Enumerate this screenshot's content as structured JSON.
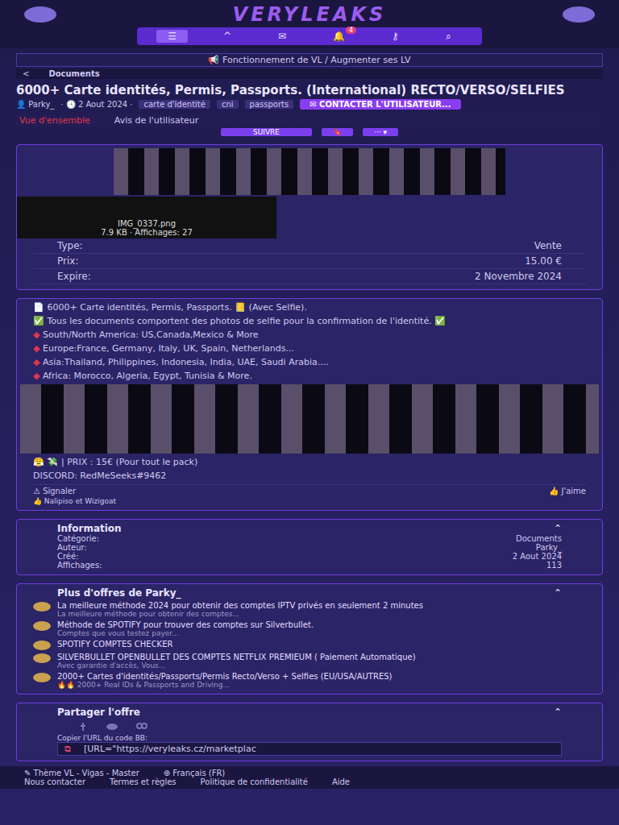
{
  "header": {
    "logo": "VERYLEAKS",
    "nav": [
      {
        "icon": "☰",
        "selected": true,
        "badge": ""
      },
      {
        "icon": "^",
        "selected": false,
        "badge": ""
      },
      {
        "icon": "✉",
        "selected": false,
        "badge": ""
      },
      {
        "icon": "🔔",
        "selected": false,
        "badge": "4"
      },
      {
        "icon": "⚷",
        "selected": false,
        "badge": ""
      },
      {
        "icon": "⌕",
        "selected": false,
        "badge": ""
      }
    ]
  },
  "notice": {
    "icon": "📢",
    "text": "Fonctionnement de VL / Augmenter ses LV"
  },
  "breadcrumb": {
    "back": "<",
    "label": "Documents"
  },
  "listing": {
    "title": "6000+ Carte identités, Permis, Passports. (International) RECTO/VERSO/SELFIES",
    "author": "Parky_",
    "date": "2 Aout 2024",
    "tags": [
      "carte d'identité",
      "cni",
      "passports"
    ],
    "contact": "CONTACTER L'UTILISATEUR..."
  },
  "tabs": [
    {
      "label": "Vue d'ensemble",
      "selected": true
    },
    {
      "label": "Avis de l'utilisateur",
      "selected": false
    }
  ],
  "actions": {
    "follow": "SUIVRE",
    "bookmark": "🔖",
    "more": "··· ▾"
  },
  "attachment": {
    "name": "IMG_0337.png",
    "meta": "7.9 KB · Affichages: 27"
  },
  "details": [
    {
      "label": "Type:",
      "value": "Vente"
    },
    {
      "label": "Prix:",
      "value": "15.00 €"
    },
    {
      "label": "Expire:",
      "value": "2 Novembre 2024"
    }
  ],
  "description": {
    "intro": "📄 6000+ Carte identités, Permis, Passports. 📒 (Avec Selfie).",
    "selfie": "✅ Tous les documents comportent des photos de selfie pour la confirmation de l'identité. ✅",
    "regions": [
      "South/North America: US,Canada,Mexico & More",
      "Europe:France, Germany, Italy, UK, Spain, Netherlands...",
      "Asia:Thailand, Philippines, Indonesia, India, UAE, Saudi Arabia....",
      "Africa: Morocco, Algeria, Egypt, Tunisia & More."
    ],
    "bullet": "◆",
    "price": "😤 💸 | PRIX : 15€ (Pour tout le pack)",
    "discord": "DISCORD: RedMeSeeks#9462",
    "report": "⚠ Signaler",
    "like": "👍 J'aime",
    "reactions": "Nalipiso et Wizigoat"
  },
  "information": {
    "title": "Information",
    "rows": [
      {
        "label": "Catégorie:",
        "value": "Documents"
      },
      {
        "label": "Auteur:",
        "value": "Parky_"
      },
      {
        "label": "Créé:",
        "value": "2 Aout 2024"
      },
      {
        "label": "Affichages:",
        "value": "113"
      }
    ]
  },
  "more_offers": {
    "title": "Plus d'offres de Parky_",
    "items": [
      {
        "title": "La meilleure méthode 2024 pour obtenir des comptes IPTV privés en seulement 2 minutes",
        "sub": "La meilleure méthode pour obtenir des comptes..."
      },
      {
        "title": "Méthode de SPOTIFY pour trouver des comptes sur Silverbullet.",
        "sub": "Comptes que vous testez payer..."
      },
      {
        "title": "SPOTIFY COMPTES CHECKER",
        "sub": ""
      },
      {
        "title": "SILVERBULLET OPENBULLET DES COMPTES NETFLIX PREMIEUM ( Paiement Automatique)",
        "sub": "Avec garantie d'accès, Vous..."
      },
      {
        "title": "2000+ Cartes d'identités/Passports/Permis Recto/Verso + Selfies (EU/USA/AUTRES)",
        "sub": "🔥🔥 2000+ Real IDs & Passports and Driving..."
      }
    ]
  },
  "share": {
    "title": "Partager l'offre",
    "label": "Copier l'URL du code BB:",
    "value": "[URL=\"https://veryleaks.cz/marketplac"
  },
  "footer": {
    "theme": "Thème VL - Vigas - Master",
    "language": "Français (FR)",
    "links": [
      "Nous contacter",
      "Termes et règles",
      "Politique de confidentialité",
      "Aide"
    ]
  }
}
